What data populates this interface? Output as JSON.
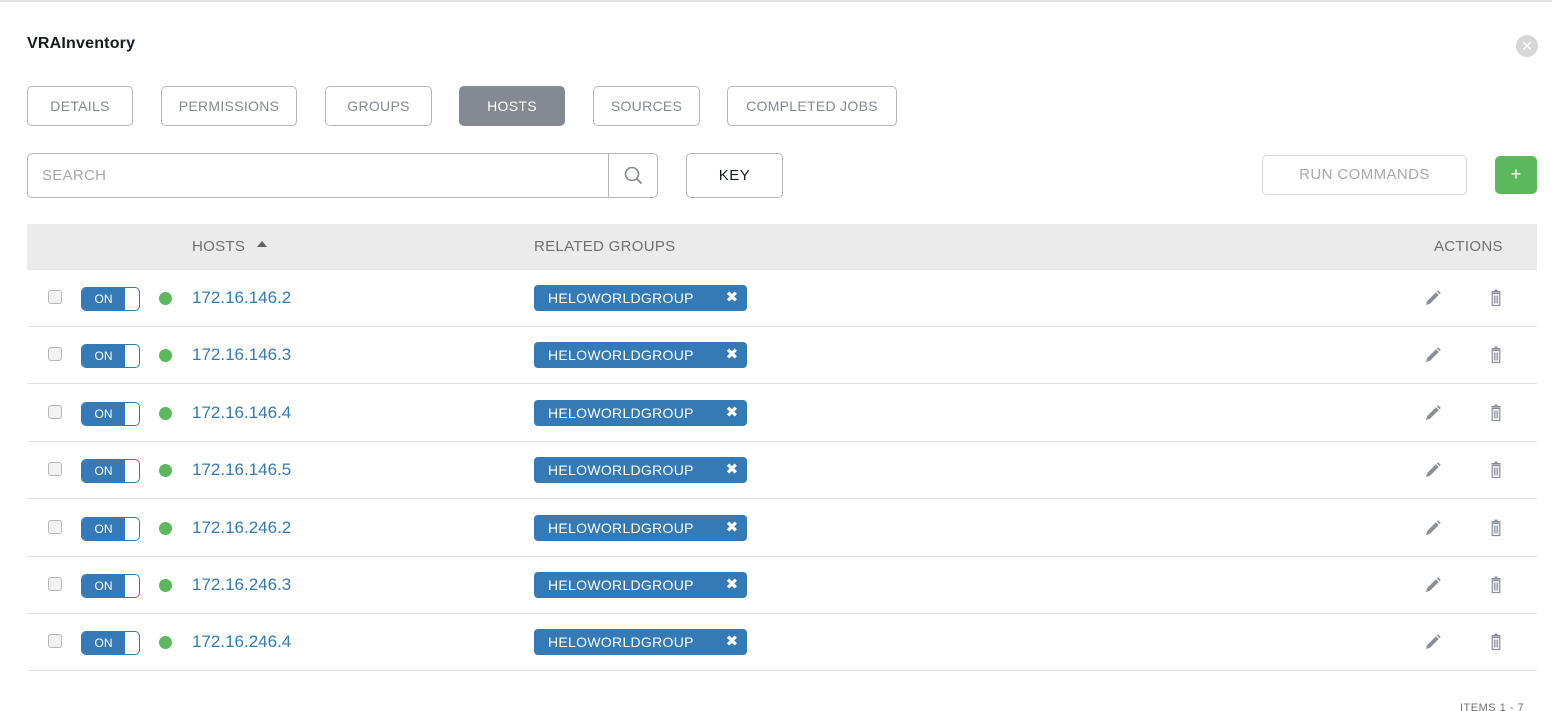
{
  "window": {
    "title": "VRAInventory",
    "close_icon": "close-circle-icon"
  },
  "tabs": [
    {
      "label": "DETAILS",
      "active": false
    },
    {
      "label": "PERMISSIONS",
      "active": false
    },
    {
      "label": "GROUPS",
      "active": false
    },
    {
      "label": "HOSTS",
      "active": true
    },
    {
      "label": "SOURCES",
      "active": false
    },
    {
      "label": "COMPLETED JOBS",
      "active": false
    }
  ],
  "search": {
    "placeholder": "SEARCH",
    "value": "",
    "icon": "search-icon"
  },
  "toolbar": {
    "key_label": "KEY",
    "run_commands_label": "RUN COMMANDS",
    "add_label": "+"
  },
  "table": {
    "columns": {
      "hosts": "HOSTS",
      "related_groups": "RELATED GROUPS",
      "actions": "ACTIONS"
    },
    "sort": {
      "column": "hosts",
      "direction": "ascending"
    },
    "rows": [
      {
        "toggle": "ON",
        "host": "172.16.146.2",
        "group": "HELOWORLDGROUP"
      },
      {
        "toggle": "ON",
        "host": "172.16.146.3",
        "group": "HELOWORLDGROUP"
      },
      {
        "toggle": "ON",
        "host": "172.16.146.4",
        "group": "HELOWORLDGROUP"
      },
      {
        "toggle": "ON",
        "host": "172.16.146.5",
        "group": "HELOWORLDGROUP"
      },
      {
        "toggle": "ON",
        "host": "172.16.246.2",
        "group": "HELOWORLDGROUP"
      },
      {
        "toggle": "ON",
        "host": "172.16.246.3",
        "group": "HELOWORLDGROUP"
      },
      {
        "toggle": "ON",
        "host": "172.16.246.4",
        "group": "HELOWORLDGROUP"
      }
    ],
    "tag_remove_glyph": "✖"
  },
  "footer": {
    "items_label": "ITEMS 1 - 7"
  },
  "colors": {
    "accent": "#337ab7",
    "status_ok": "#5cb85c",
    "add": "#5cb85c",
    "active_tab": "#848992"
  }
}
